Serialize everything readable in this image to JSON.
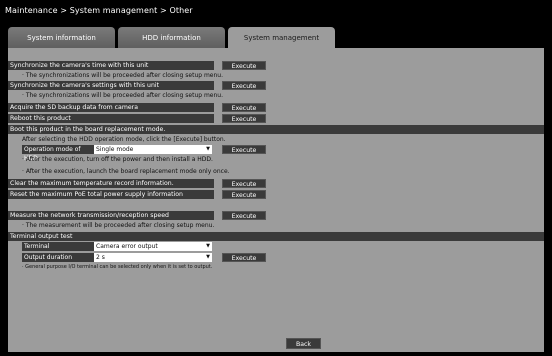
{
  "breadcrumb": "Maintenance > System management > Other",
  "tabs": [
    {
      "label": "System information"
    },
    {
      "label": "HDD information"
    },
    {
      "label": "System management"
    }
  ],
  "rows": {
    "sync_time": {
      "label": "Synchronize the camera's time with this unit",
      "button": "Execute",
      "note": "· The synchronizations will be proceeded after closing setup menu."
    },
    "sync_settings": {
      "label": "Synchronize the camera's settings with this unit",
      "button": "Execute",
      "note": "· The synchronizations will be proceeded after closing setup menu."
    },
    "sd_backup": {
      "label": "Acquire the SD backup data from camera",
      "button": "Execute"
    },
    "reboot": {
      "label": "Reboot this product",
      "button": "Execute"
    },
    "board_replacement": {
      "label": "Boot this product in the board replacement mode.",
      "instruction": "After selecting the HDD operation mode, click the [Execute] button.",
      "mode_label": "Operation mode of HDD",
      "mode_value": "Single mode",
      "button": "Execute",
      "note1": "· After the execution, turn off the power and then install a HDD.",
      "note2": "· After the execution, launch the board replacement mode only once."
    },
    "clear_temp": {
      "label": "Clear the maximum temperature record information.",
      "button": "Execute"
    },
    "reset_poe": {
      "label": "Reset the maximum PoE total power supply information",
      "button": "Execute"
    },
    "network_speed": {
      "label": "Measure the network transmission/reception speed",
      "button": "Execute",
      "note": "· The measurement will be proceeded after closing setup menu."
    },
    "terminal_test": {
      "label": "Terminal output test",
      "terminal_label": "Terminal",
      "terminal_value": "Camera error output",
      "duration_label": "Output duration",
      "duration_value": "2 s",
      "button": "Execute",
      "note": "· General purpose I/O terminal can be selected only when it is set to output."
    }
  },
  "back_label": "Back"
}
